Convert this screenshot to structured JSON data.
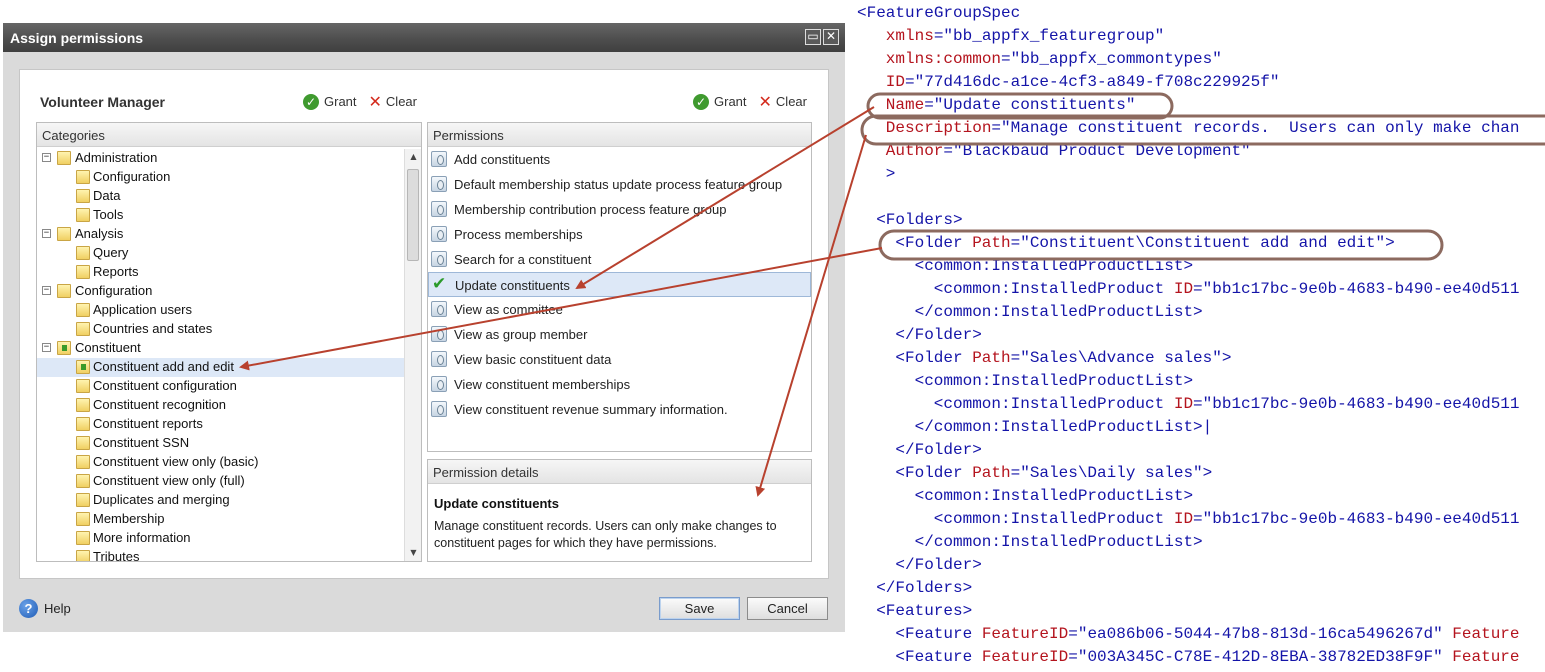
{
  "dialog": {
    "title": "Assign permissions",
    "section_title": "Volunteer Manager",
    "grant_label": "Grant",
    "clear_label": "Clear",
    "categories_header": "Categories",
    "permissions_header": "Permissions",
    "details_header": "Permission details",
    "tree": [
      {
        "label": "Administration",
        "level": 0
      },
      {
        "label": "Configuration",
        "level": 1
      },
      {
        "label": "Data",
        "level": 1
      },
      {
        "label": "Tools",
        "level": 1
      },
      {
        "label": "Analysis",
        "level": 0
      },
      {
        "label": "Query",
        "level": 1
      },
      {
        "label": "Reports",
        "level": 1
      },
      {
        "label": "Configuration",
        "level": 0
      },
      {
        "label": "Application users",
        "level": 1
      },
      {
        "label": "Countries and states",
        "level": 1
      },
      {
        "label": "Constituent",
        "level": 0
      },
      {
        "label": "Constituent add and edit",
        "level": 1,
        "selected": true
      },
      {
        "label": "Constituent configuration",
        "level": 1
      },
      {
        "label": "Constituent recognition",
        "level": 1
      },
      {
        "label": "Constituent reports",
        "level": 1
      },
      {
        "label": "Constituent SSN",
        "level": 1
      },
      {
        "label": "Constituent view only (basic)",
        "level": 1
      },
      {
        "label": "Constituent view only (full)",
        "level": 1
      },
      {
        "label": "Duplicates and merging",
        "level": 1
      },
      {
        "label": "Membership",
        "level": 1
      },
      {
        "label": "More information",
        "level": 1
      },
      {
        "label": "Tributes",
        "level": 1
      }
    ],
    "permissions": [
      {
        "label": "Add constituents"
      },
      {
        "label": "Default membership status update process feature group"
      },
      {
        "label": "Membership contribution process feature group"
      },
      {
        "label": "Process memberships"
      },
      {
        "label": "Search for a constituent"
      },
      {
        "label": "Update constituents",
        "granted": true
      },
      {
        "label": "View as committee"
      },
      {
        "label": "View as group member"
      },
      {
        "label": "View basic constituent data"
      },
      {
        "label": "View constituent memberships"
      },
      {
        "label": "View constituent revenue summary information."
      }
    ],
    "detail": {
      "title": "Update constituents",
      "description": "Manage constituent records.  Users can only make changes to constituent pages for which they have permissions."
    },
    "help_label": "Help",
    "save_label": "Save",
    "cancel_label": "Cancel"
  },
  "xml_lines": [
    {
      "indent": 0,
      "segments": [
        {
          "t": "<FeatureGroupSpec",
          "c": "b"
        }
      ]
    },
    {
      "indent": 3,
      "segments": [
        {
          "t": "xmlns",
          "c": "r"
        },
        {
          "t": "=\"bb_appfx_featuregroup\"",
          "c": "b"
        }
      ]
    },
    {
      "indent": 3,
      "segments": [
        {
          "t": "xmlns:common",
          "c": "r"
        },
        {
          "t": "=\"bb_appfx_commontypes\"",
          "c": "b"
        }
      ]
    },
    {
      "indent": 3,
      "segments": [
        {
          "t": "ID",
          "c": "r"
        },
        {
          "t": "=\"77d416dc-a1ce-4cf3-a849-f708c229925f\"",
          "c": "b"
        }
      ]
    },
    {
      "indent": 3,
      "segments": [
        {
          "t": "Name",
          "c": "r"
        },
        {
          "t": "=\"Update constituents\"",
          "c": "b"
        }
      ]
    },
    {
      "indent": 3,
      "segments": [
        {
          "t": "Description",
          "c": "r"
        },
        {
          "t": "=\"Manage constituent records.  Users can only make chan",
          "c": "b"
        }
      ]
    },
    {
      "indent": 3,
      "segments": [
        {
          "t": "Author",
          "c": "r"
        },
        {
          "t": "=\"Blackbaud Product Development\"",
          "c": "b"
        }
      ]
    },
    {
      "indent": 3,
      "segments": [
        {
          "t": ">",
          "c": "b"
        }
      ]
    },
    {
      "indent": 0,
      "segments": []
    },
    {
      "indent": 2,
      "segments": [
        {
          "t": "<Folders>",
          "c": "b"
        }
      ]
    },
    {
      "indent": 4,
      "segments": [
        {
          "t": "<Folder ",
          "c": "b"
        },
        {
          "t": "Path",
          "c": "r"
        },
        {
          "t": "=\"Constituent\\Constituent add and edit\">",
          "c": "b"
        }
      ]
    },
    {
      "indent": 6,
      "segments": [
        {
          "t": "<common:InstalledProductList>",
          "c": "b"
        }
      ]
    },
    {
      "indent": 8,
      "segments": [
        {
          "t": "<common:InstalledProduct ",
          "c": "b"
        },
        {
          "t": "ID",
          "c": "r"
        },
        {
          "t": "=\"bb1c17bc-9e0b-4683-b490-ee40d511",
          "c": "b"
        }
      ]
    },
    {
      "indent": 6,
      "segments": [
        {
          "t": "</common:InstalledProductList>",
          "c": "b"
        }
      ]
    },
    {
      "indent": 4,
      "segments": [
        {
          "t": "</Folder>",
          "c": "b"
        }
      ]
    },
    {
      "indent": 4,
      "segments": [
        {
          "t": "<Folder ",
          "c": "b"
        },
        {
          "t": "Path",
          "c": "r"
        },
        {
          "t": "=\"Sales\\Advance sales\">",
          "c": "b"
        }
      ]
    },
    {
      "indent": 6,
      "segments": [
        {
          "t": "<common:InstalledProductList>",
          "c": "b"
        }
      ]
    },
    {
      "indent": 8,
      "segments": [
        {
          "t": "<common:InstalledProduct ",
          "c": "b"
        },
        {
          "t": "ID",
          "c": "r"
        },
        {
          "t": "=\"bb1c17bc-9e0b-4683-b490-ee40d511",
          "c": "b"
        }
      ]
    },
    {
      "indent": 6,
      "segments": [
        {
          "t": "</common:InstalledProductList>|",
          "c": "b"
        }
      ]
    },
    {
      "indent": 4,
      "segments": [
        {
          "t": "</Folder>",
          "c": "b"
        }
      ]
    },
    {
      "indent": 4,
      "segments": [
        {
          "t": "<Folder ",
          "c": "b"
        },
        {
          "t": "Path",
          "c": "r"
        },
        {
          "t": "=\"Sales\\Daily sales\">",
          "c": "b"
        }
      ]
    },
    {
      "indent": 6,
      "segments": [
        {
          "t": "<common:InstalledProductList>",
          "c": "b"
        }
      ]
    },
    {
      "indent": 8,
      "segments": [
        {
          "t": "<common:InstalledProduct ",
          "c": "b"
        },
        {
          "t": "ID",
          "c": "r"
        },
        {
          "t": "=\"bb1c17bc-9e0b-4683-b490-ee40d511",
          "c": "b"
        }
      ]
    },
    {
      "indent": 6,
      "segments": [
        {
          "t": "</common:InstalledProductList>",
          "c": "b"
        }
      ]
    },
    {
      "indent": 4,
      "segments": [
        {
          "t": "</Folder>",
          "c": "b"
        }
      ]
    },
    {
      "indent": 2,
      "segments": [
        {
          "t": "</Folders>",
          "c": "b"
        }
      ]
    },
    {
      "indent": 2,
      "segments": [
        {
          "t": "<Features>",
          "c": "b"
        }
      ]
    },
    {
      "indent": 4,
      "segments": [
        {
          "t": "<Feature ",
          "c": "b"
        },
        {
          "t": "FeatureID",
          "c": "r"
        },
        {
          "t": "=\"ea086b06-5044-47b8-813d-16ca5496267d\" ",
          "c": "b"
        },
        {
          "t": "Feature",
          "c": "r"
        }
      ]
    },
    {
      "indent": 4,
      "segments": [
        {
          "t": "<Feature ",
          "c": "b"
        },
        {
          "t": "FeatureID",
          "c": "r"
        },
        {
          "t": "=\"003A345C-C78E-412D-8EBA-38782ED38F9F\" ",
          "c": "b"
        },
        {
          "t": "Feature",
          "c": "r"
        }
      ]
    }
  ],
  "colors": {
    "titlebar": "#4e4e4e",
    "tree_selected": "#dde8f7",
    "xml_tag": "#1414a8",
    "xml_attr": "#b4141e",
    "annotation": "#b8412e"
  }
}
